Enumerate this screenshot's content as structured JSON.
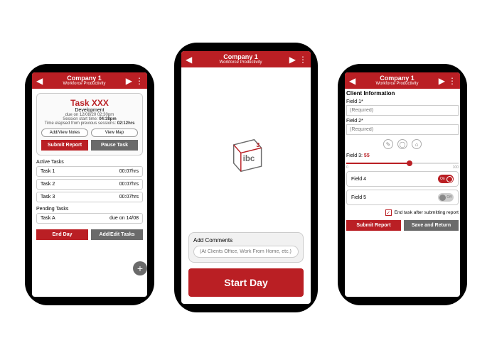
{
  "header": {
    "company": "Company 1",
    "subtitle": "Workforce Productivity"
  },
  "colors": {
    "accent": "#ba1f24",
    "gray": "#6a6a6a"
  },
  "phone1": {
    "task": {
      "name": "Task XXX",
      "category": "Development",
      "due": "due on 12/08/20 02:30pm",
      "session_start_label": "Session start time:",
      "session_start_value": "04:38pm",
      "elapsed_label": "Time elapsed from previous sessions:",
      "elapsed_value": "02:12hrs"
    },
    "pills": {
      "notes": "Add/View Notes",
      "map": "View Map"
    },
    "buttons": {
      "submit": "Submit Report",
      "pause": "Pause Task"
    },
    "active_label": "Active Tasks",
    "active": [
      {
        "name": "Task 1",
        "time": "00:07hrs"
      },
      {
        "name": "Task 2",
        "time": "00:07hrs"
      },
      {
        "name": "Task 3",
        "time": "00:07hrs"
      }
    ],
    "pending_label": "Pending Tasks",
    "pending": [
      {
        "name": "Task A",
        "due": "due on 14/08"
      }
    ],
    "fab": "+",
    "footer": {
      "end": "End Day",
      "edit": "Add/Edit Tasks"
    }
  },
  "phone2": {
    "logo_text": "ibc",
    "logo_sup": "3",
    "comments_label": "Add Comments",
    "comments_placeholder": "(At Clients Office, Work From Home, etc.)",
    "start": "Start Day"
  },
  "phone3": {
    "heading": "Client Information",
    "field1_label": "Field 1*",
    "field2_label": "Field 2*",
    "required": "(Required)",
    "field3_label": "Field 3:",
    "field3_value": "55",
    "slider_min": "0",
    "slider_max": "100",
    "field4_label": "Field 4",
    "field4_state": "On",
    "field5_label": "Field 5",
    "field5_state": "Off",
    "end_task": "End task after submitting report",
    "submit": "Submit Report",
    "save": "Save and Return"
  }
}
